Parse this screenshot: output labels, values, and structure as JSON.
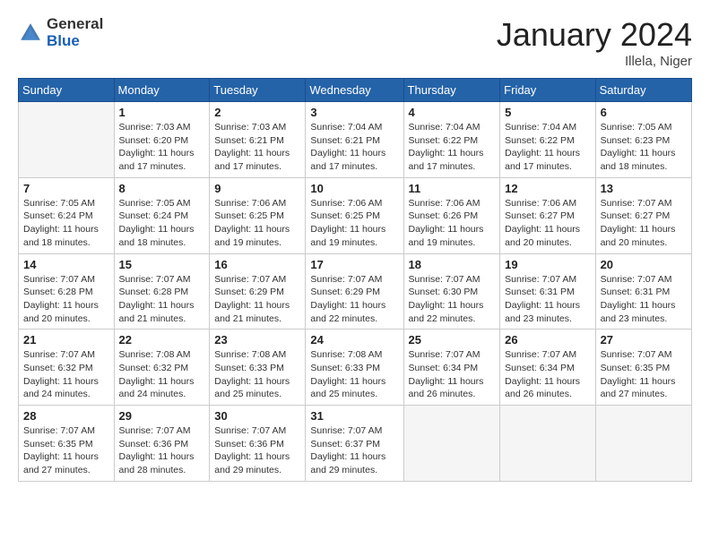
{
  "header": {
    "logo_general": "General",
    "logo_blue": "Blue",
    "title": "January 2024",
    "location": "Illela, Niger"
  },
  "weekdays": [
    "Sunday",
    "Monday",
    "Tuesday",
    "Wednesday",
    "Thursday",
    "Friday",
    "Saturday"
  ],
  "weeks": [
    [
      {
        "day": "",
        "info": ""
      },
      {
        "day": "1",
        "info": "Sunrise: 7:03 AM\nSunset: 6:20 PM\nDaylight: 11 hours\nand 17 minutes."
      },
      {
        "day": "2",
        "info": "Sunrise: 7:03 AM\nSunset: 6:21 PM\nDaylight: 11 hours\nand 17 minutes."
      },
      {
        "day": "3",
        "info": "Sunrise: 7:04 AM\nSunset: 6:21 PM\nDaylight: 11 hours\nand 17 minutes."
      },
      {
        "day": "4",
        "info": "Sunrise: 7:04 AM\nSunset: 6:22 PM\nDaylight: 11 hours\nand 17 minutes."
      },
      {
        "day": "5",
        "info": "Sunrise: 7:04 AM\nSunset: 6:22 PM\nDaylight: 11 hours\nand 17 minutes."
      },
      {
        "day": "6",
        "info": "Sunrise: 7:05 AM\nSunset: 6:23 PM\nDaylight: 11 hours\nand 18 minutes."
      }
    ],
    [
      {
        "day": "7",
        "info": "Sunrise: 7:05 AM\nSunset: 6:24 PM\nDaylight: 11 hours\nand 18 minutes."
      },
      {
        "day": "8",
        "info": "Sunrise: 7:05 AM\nSunset: 6:24 PM\nDaylight: 11 hours\nand 18 minutes."
      },
      {
        "day": "9",
        "info": "Sunrise: 7:06 AM\nSunset: 6:25 PM\nDaylight: 11 hours\nand 19 minutes."
      },
      {
        "day": "10",
        "info": "Sunrise: 7:06 AM\nSunset: 6:25 PM\nDaylight: 11 hours\nand 19 minutes."
      },
      {
        "day": "11",
        "info": "Sunrise: 7:06 AM\nSunset: 6:26 PM\nDaylight: 11 hours\nand 19 minutes."
      },
      {
        "day": "12",
        "info": "Sunrise: 7:06 AM\nSunset: 6:27 PM\nDaylight: 11 hours\nand 20 minutes."
      },
      {
        "day": "13",
        "info": "Sunrise: 7:07 AM\nSunset: 6:27 PM\nDaylight: 11 hours\nand 20 minutes."
      }
    ],
    [
      {
        "day": "14",
        "info": "Sunrise: 7:07 AM\nSunset: 6:28 PM\nDaylight: 11 hours\nand 20 minutes."
      },
      {
        "day": "15",
        "info": "Sunrise: 7:07 AM\nSunset: 6:28 PM\nDaylight: 11 hours\nand 21 minutes."
      },
      {
        "day": "16",
        "info": "Sunrise: 7:07 AM\nSunset: 6:29 PM\nDaylight: 11 hours\nand 21 minutes."
      },
      {
        "day": "17",
        "info": "Sunrise: 7:07 AM\nSunset: 6:29 PM\nDaylight: 11 hours\nand 22 minutes."
      },
      {
        "day": "18",
        "info": "Sunrise: 7:07 AM\nSunset: 6:30 PM\nDaylight: 11 hours\nand 22 minutes."
      },
      {
        "day": "19",
        "info": "Sunrise: 7:07 AM\nSunset: 6:31 PM\nDaylight: 11 hours\nand 23 minutes."
      },
      {
        "day": "20",
        "info": "Sunrise: 7:07 AM\nSunset: 6:31 PM\nDaylight: 11 hours\nand 23 minutes."
      }
    ],
    [
      {
        "day": "21",
        "info": "Sunrise: 7:07 AM\nSunset: 6:32 PM\nDaylight: 11 hours\nand 24 minutes."
      },
      {
        "day": "22",
        "info": "Sunrise: 7:08 AM\nSunset: 6:32 PM\nDaylight: 11 hours\nand 24 minutes."
      },
      {
        "day": "23",
        "info": "Sunrise: 7:08 AM\nSunset: 6:33 PM\nDaylight: 11 hours\nand 25 minutes."
      },
      {
        "day": "24",
        "info": "Sunrise: 7:08 AM\nSunset: 6:33 PM\nDaylight: 11 hours\nand 25 minutes."
      },
      {
        "day": "25",
        "info": "Sunrise: 7:07 AM\nSunset: 6:34 PM\nDaylight: 11 hours\nand 26 minutes."
      },
      {
        "day": "26",
        "info": "Sunrise: 7:07 AM\nSunset: 6:34 PM\nDaylight: 11 hours\nand 26 minutes."
      },
      {
        "day": "27",
        "info": "Sunrise: 7:07 AM\nSunset: 6:35 PM\nDaylight: 11 hours\nand 27 minutes."
      }
    ],
    [
      {
        "day": "28",
        "info": "Sunrise: 7:07 AM\nSunset: 6:35 PM\nDaylight: 11 hours\nand 27 minutes."
      },
      {
        "day": "29",
        "info": "Sunrise: 7:07 AM\nSunset: 6:36 PM\nDaylight: 11 hours\nand 28 minutes."
      },
      {
        "day": "30",
        "info": "Sunrise: 7:07 AM\nSunset: 6:36 PM\nDaylight: 11 hours\nand 29 minutes."
      },
      {
        "day": "31",
        "info": "Sunrise: 7:07 AM\nSunset: 6:37 PM\nDaylight: 11 hours\nand 29 minutes."
      },
      {
        "day": "",
        "info": ""
      },
      {
        "day": "",
        "info": ""
      },
      {
        "day": "",
        "info": ""
      }
    ]
  ]
}
